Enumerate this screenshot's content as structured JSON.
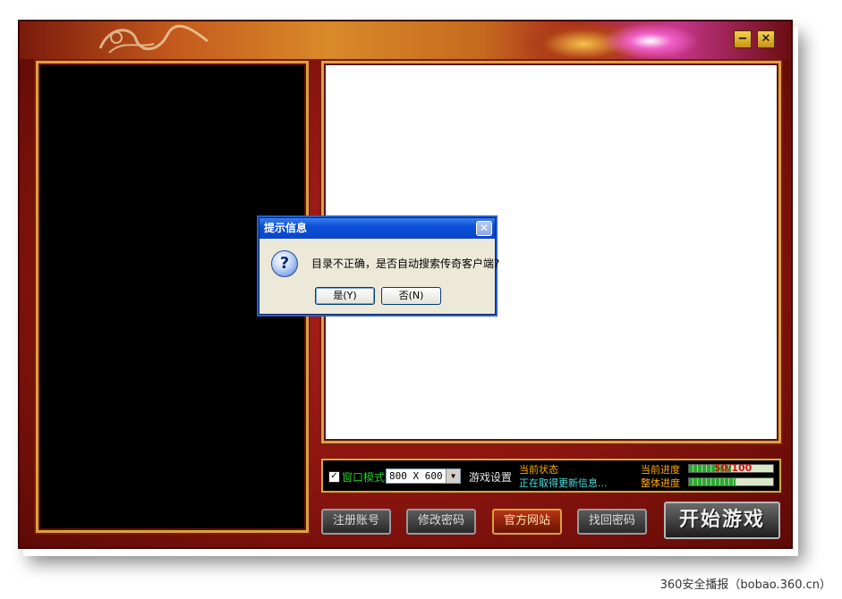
{
  "window": {
    "minimize_glyph": "−",
    "close_glyph": "✕"
  },
  "settings": {
    "window_mode_label": "窗口模式",
    "window_mode_checked": true,
    "resolution_value": "800 X 600",
    "game_settings_label": "游戏设置",
    "current_status_label": "当前状态",
    "status_text": "正在取得更新信息...",
    "current_progress_label": "当前进度",
    "current_progress_text": "50/100",
    "current_progress_fraction": 0.5,
    "overall_progress_label": "整体进度",
    "overall_progress_fraction": 0.55
  },
  "buttons": {
    "register": "注册账号",
    "change_password": "修改密码",
    "official_site": "官方网站",
    "recover_password": "找回密码",
    "start_game": "开始游戏"
  },
  "dialog": {
    "title": "提示信息",
    "message": "目录不正确，是否自动搜索传奇客户端?",
    "yes_label": "是(Y)",
    "no_label": "否(N)",
    "icon": "question-icon"
  },
  "watermark": "360安全播报（bobao.360.cn）",
  "colors": {
    "frame_red": "#8a140f",
    "gold": "#e0a040",
    "status_green": "#22cc22",
    "status_cyan": "#44e0e0",
    "label_orange": "#ffaa00"
  }
}
